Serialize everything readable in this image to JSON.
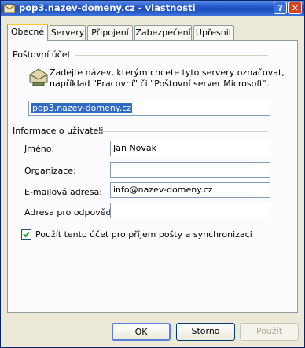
{
  "window": {
    "title": "pop3.nazev-domeny.cz - vlastnosti",
    "help_label": "?",
    "close_label": "✕"
  },
  "tabs": [
    {
      "label": "Obecné",
      "active": true
    },
    {
      "label": "Servery",
      "active": false
    },
    {
      "label": "Připojení",
      "active": false
    },
    {
      "label": "Zabezpečení",
      "active": false
    },
    {
      "label": "Upřesnit",
      "active": false
    }
  ],
  "account": {
    "group_label": "Poštovní účet",
    "description_line1": "Zadejte název, kterým chcete tyto servery označovat,",
    "description_line2": "například \"Pracovní\" či \"Poštovní server Microsoft\".",
    "name_value": "pop3.nazev-domeny.cz"
  },
  "user_info": {
    "group_label": "Informace o uživateli",
    "fields": [
      {
        "label": "Jméno:",
        "value": "Jan Novak"
      },
      {
        "label": "Organizace:",
        "value": ""
      },
      {
        "label": "E-mailová adresa:",
        "value": "info@nazev-domeny.cz"
      },
      {
        "label": "Adresa pro odpovědi:",
        "value": ""
      }
    ]
  },
  "checkbox": {
    "label": "Použít tento účet pro příjem pošty a synchronizaci",
    "checked": true
  },
  "buttons": {
    "ok": "OK",
    "cancel": "Storno",
    "apply": "Použít"
  }
}
